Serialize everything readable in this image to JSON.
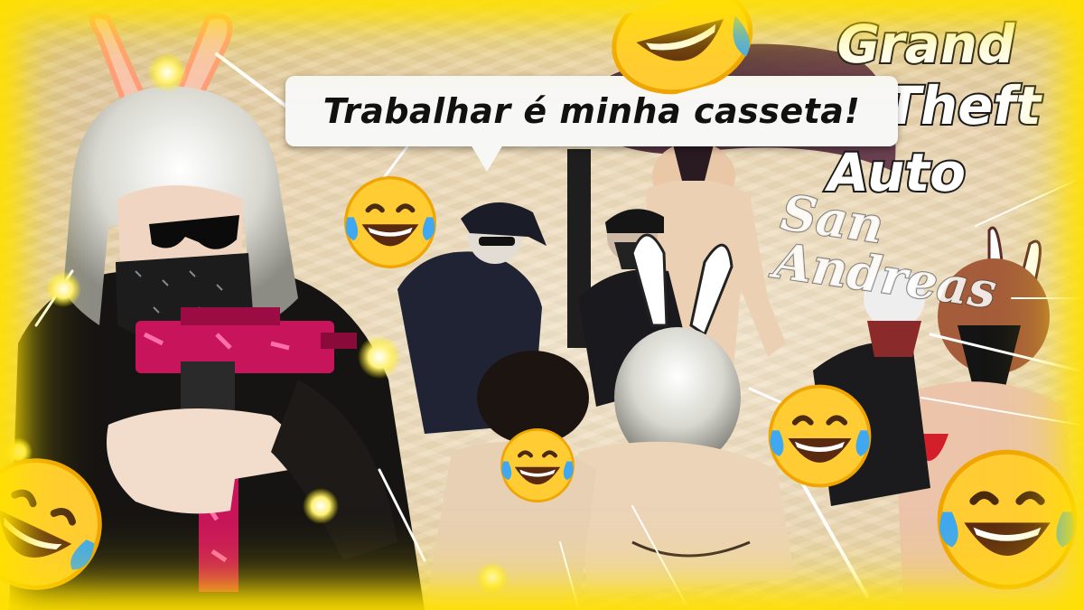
{
  "thumbnail": {
    "speech_text": "Trabalhar é minha casseta!",
    "logo": {
      "line1": "Grand",
      "line2": "Theft",
      "line3": "Auto",
      "line4": "San Andreas"
    },
    "accent_colors": {
      "glow": "#ffe000",
      "bubble": "#f7f7f5",
      "sand": "#e9d3ad",
      "gun": "#c8145a"
    },
    "icons": [
      "laughing-tears-emoji",
      "bunny-ears",
      "bandana-mask",
      "pink-uzi",
      "beach-umbrella"
    ]
  }
}
